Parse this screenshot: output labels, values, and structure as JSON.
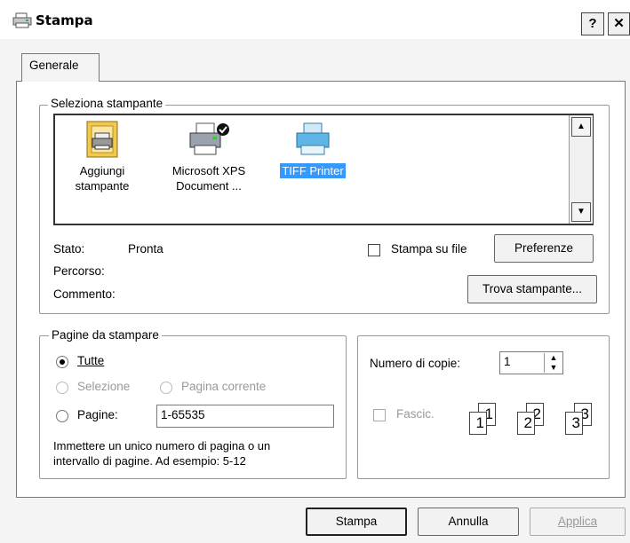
{
  "window": {
    "title": "Stampa",
    "help_button": "?",
    "close_button": "✕"
  },
  "tabs": [
    {
      "label": "Generale"
    }
  ],
  "select_printer": {
    "legend": "Seleziona stampante",
    "printers": [
      {
        "line1": "Aggiungi",
        "line2": "stampante",
        "icon": "add-printer-icon"
      },
      {
        "line1": "Microsoft XPS",
        "line2": "Document ...",
        "icon": "xps-printer-icon"
      },
      {
        "line1": "TIFF Printer",
        "line2": "",
        "icon": "tiff-printer-icon",
        "selected": true
      }
    ],
    "status_label": "Stato:",
    "status_value": "Pronta",
    "path_label": "Percorso:",
    "comment_label": "Commento:",
    "print_to_file": "Stampa su file",
    "preferences_button": "Preferenze",
    "find_printer_button": "Trova stampante..."
  },
  "page_range": {
    "legend": "Pagine da stampare",
    "all": "Tutte",
    "selection": "Selezione",
    "current_page": "Pagina corrente",
    "pages": "Pagine:",
    "pages_value": "1-65535",
    "hint_line1": "Immettere un unico numero di pagina o un",
    "hint_line2": "intervallo di pagine. Ad esempio: 5-12"
  },
  "copies": {
    "label": "Numero di copie:",
    "value": "1",
    "collate": "Fascic.",
    "collate_icons": [
      "1",
      "1",
      "2",
      "2",
      "3",
      "3"
    ]
  },
  "buttons": {
    "print": "Stampa",
    "cancel": "Annulla",
    "apply": "Applica"
  },
  "colors": {
    "selection_bg": "#3399ff",
    "selection_fg": "#ffffff"
  }
}
